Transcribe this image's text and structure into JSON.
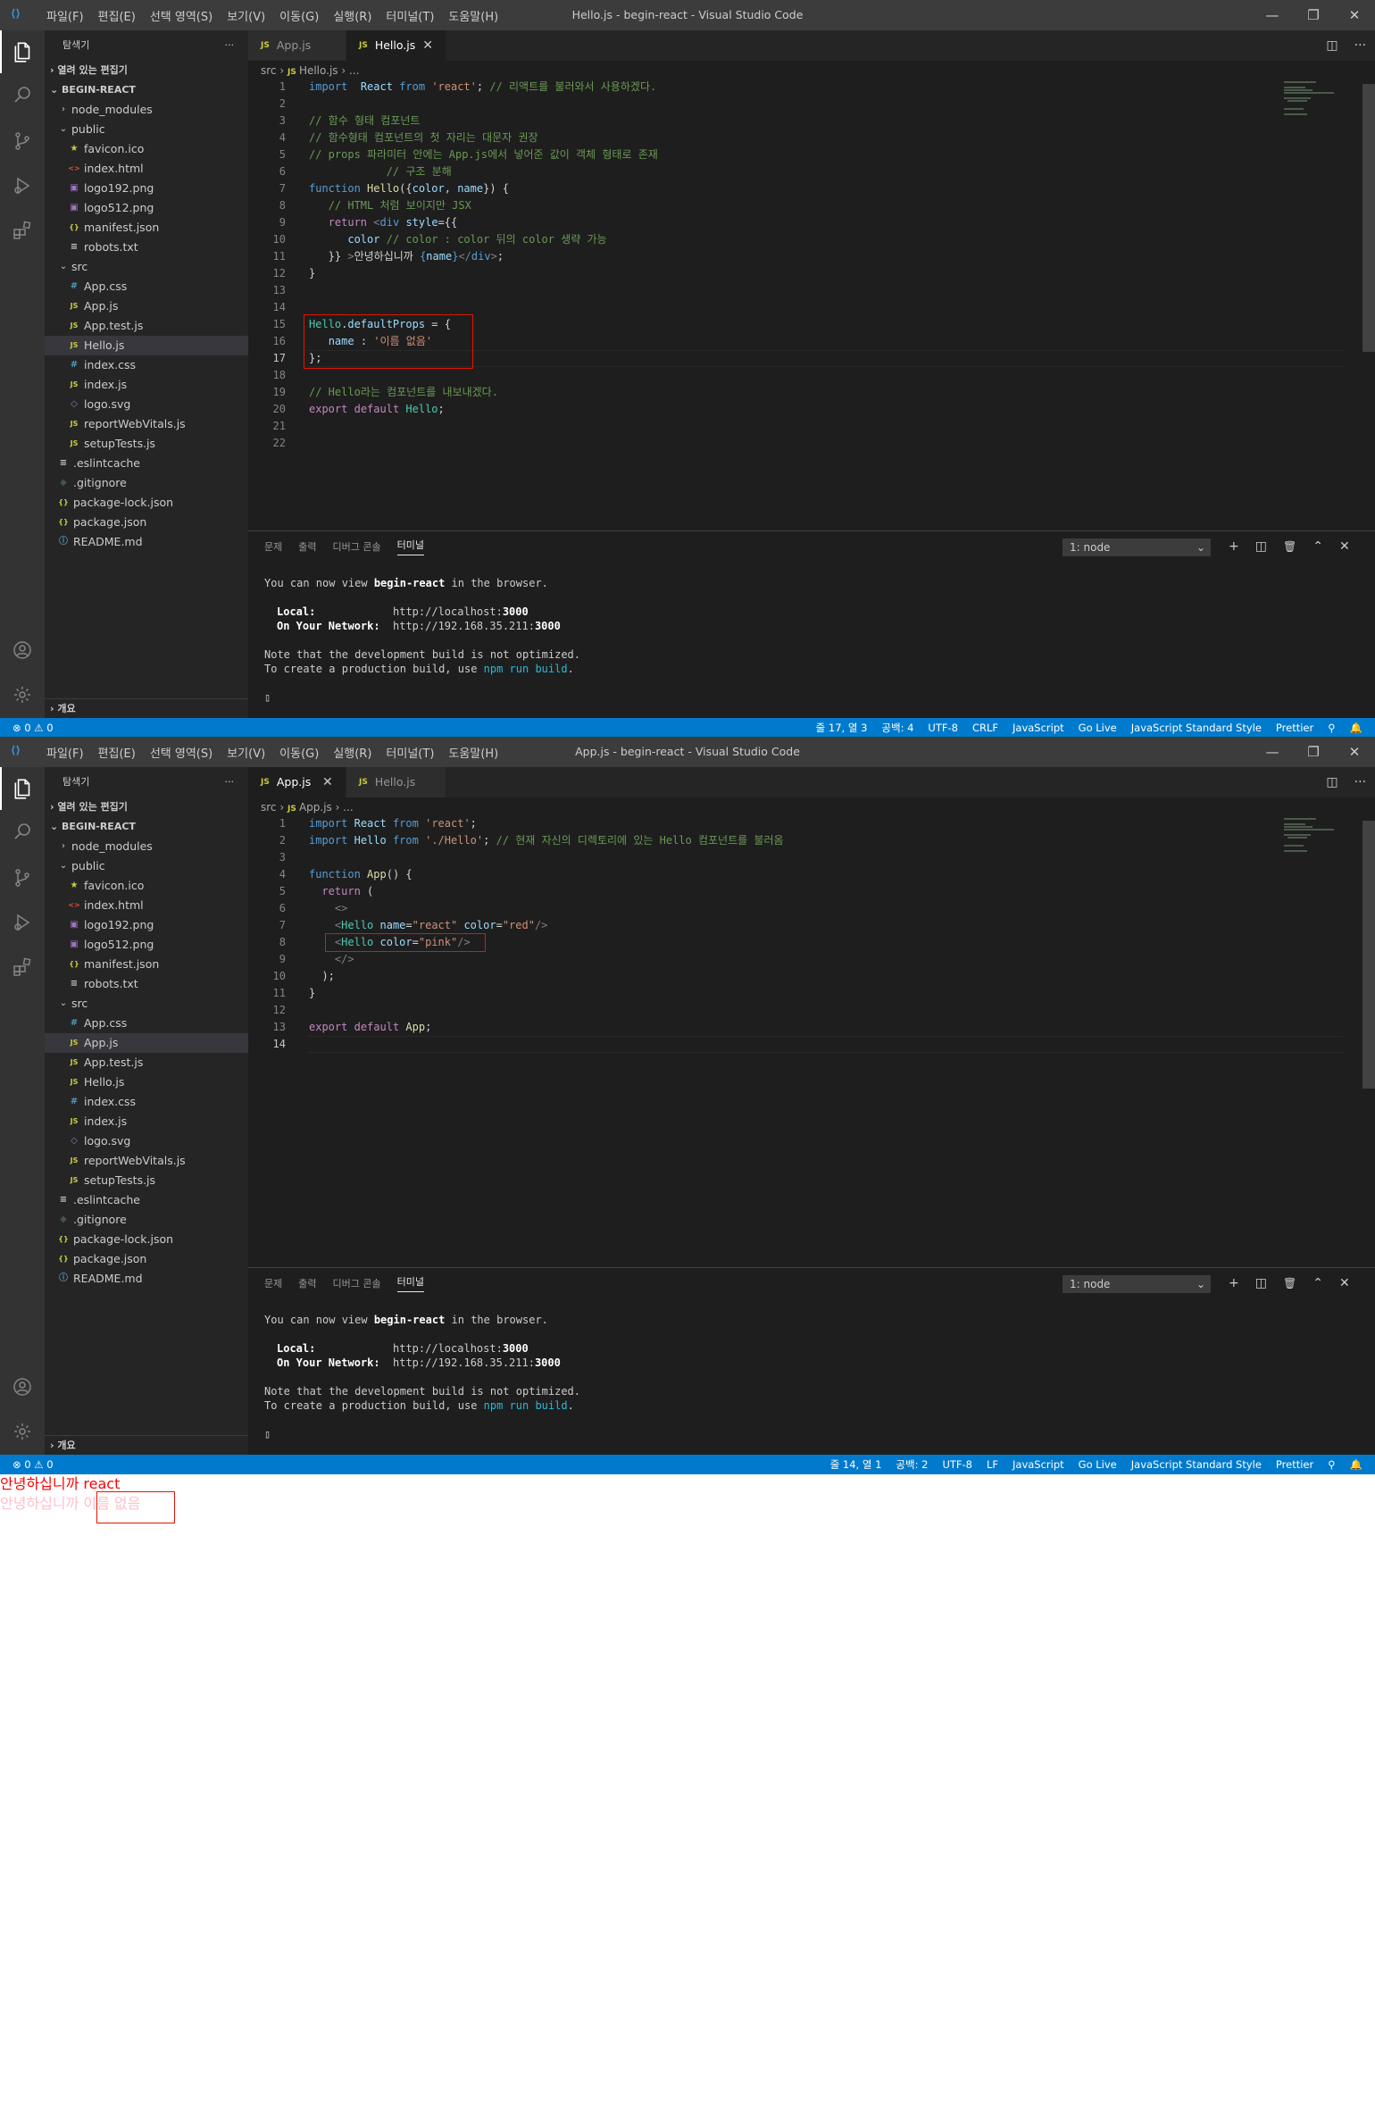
{
  "windows": [
    {
      "title": "Hello.js - begin-react - Visual Studio Code",
      "menu": [
        "파일(F)",
        "편집(E)",
        "선택 영역(S)",
        "보기(V)",
        "이동(G)",
        "실행(R)",
        "터미널(T)",
        "도움말(H)"
      ],
      "sidebar": {
        "header": "탐색기",
        "more": "···",
        "open_editors": "열려 있는 편집기",
        "project": "BEGIN-REACT",
        "selected": "Hello.js",
        "outline": "개요"
      },
      "tabs": [
        {
          "label": "App.js",
          "active": false
        },
        {
          "label": "Hello.js",
          "active": true
        }
      ],
      "breadcrumb": {
        "folder": "src",
        "file": "Hello.js",
        "rest": "..."
      },
      "code": [
        {
          "n": "1",
          "t": [
            [
              "k",
              "import"
            ],
            [
              "",
              "  "
            ],
            [
              "v",
              "React"
            ],
            [
              "",
              " "
            ],
            [
              "k",
              "from"
            ],
            [
              "",
              " "
            ],
            [
              "s",
              "'react'"
            ],
            [
              "",
              "; "
            ],
            [
              "c",
              "// 리액트를 불러와서 사용하겠다."
            ]
          ]
        },
        {
          "n": "2",
          "t": []
        },
        {
          "n": "3",
          "t": [
            [
              "c",
              "// 함수 형태 컴포넌트"
            ]
          ]
        },
        {
          "n": "4",
          "t": [
            [
              "c",
              "// 함수형태 컴포넌트의 첫 자리는 대문자 권장"
            ]
          ]
        },
        {
          "n": "5",
          "t": [
            [
              "c",
              "// props 파라미터 안에는 App.js에서 넣어준 값이 객체 형태로 존재"
            ]
          ]
        },
        {
          "n": "6",
          "t": [
            [
              "c",
              "            // 구조 분해"
            ]
          ]
        },
        {
          "n": "7",
          "t": [
            [
              "k",
              "function"
            ],
            [
              "",
              " "
            ],
            [
              "f",
              "Hello"
            ],
            [
              "",
              "({"
            ],
            [
              "v",
              "color"
            ],
            [
              "",
              ", "
            ],
            [
              "v",
              "name"
            ],
            [
              "",
              "}) {"
            ]
          ]
        },
        {
          "n": "8",
          "t": [
            [
              "",
              "   "
            ],
            [
              "c",
              "// HTML 처럼 보이지만 JSX"
            ]
          ]
        },
        {
          "n": "9",
          "t": [
            [
              "",
              "   "
            ],
            [
              "kc",
              "return"
            ],
            [
              "",
              " "
            ],
            [
              "p",
              "<"
            ],
            [
              "k",
              "div"
            ],
            [
              "",
              " "
            ],
            [
              "v",
              "style"
            ],
            [
              "",
              "={{"
            ]
          ]
        },
        {
          "n": "10",
          "t": [
            [
              "",
              "      "
            ],
            [
              "v",
              "color"
            ],
            [
              "",
              " "
            ],
            [
              "c",
              "// color : color 뒤의 color 생략 가능"
            ]
          ]
        },
        {
          "n": "11",
          "t": [
            [
              "",
              "   }} "
            ],
            [
              "p",
              ">"
            ],
            [
              "",
              "안녕하십니까 "
            ],
            [
              "k",
              "{"
            ],
            [
              "v",
              "name"
            ],
            [
              "k",
              "}"
            ],
            [
              "p",
              "</"
            ],
            [
              "k",
              "div"
            ],
            [
              "p",
              ">"
            ],
            [
              "",
              ";"
            ]
          ]
        },
        {
          "n": "12",
          "t": [
            [
              "",
              "}"
            ]
          ]
        },
        {
          "n": "13",
          "t": []
        },
        {
          "n": "14",
          "t": []
        },
        {
          "n": "15",
          "t": [
            [
              "t",
              "Hello"
            ],
            [
              "",
              "."
            ],
            [
              "v",
              "defaultProps"
            ],
            [
              "",
              " = {"
            ]
          ]
        },
        {
          "n": "16",
          "t": [
            [
              "",
              "   "
            ],
            [
              "v",
              "name"
            ],
            [
              "",
              " : "
            ],
            [
              "s",
              "'이름 없음'"
            ]
          ]
        },
        {
          "n": "17",
          "t": [
            [
              "",
              "};"
            ]
          ]
        },
        {
          "n": "18",
          "t": []
        },
        {
          "n": "19",
          "t": [
            [
              "c",
              "// Hello라는 컴포넌트를 내보내겠다."
            ]
          ]
        },
        {
          "n": "20",
          "t": [
            [
              "kc",
              "export"
            ],
            [
              "",
              " "
            ],
            [
              "kc",
              "default"
            ],
            [
              "",
              " "
            ],
            [
              "t",
              "Hello"
            ],
            [
              "",
              ";"
            ]
          ]
        },
        {
          "n": "21",
          "t": []
        },
        {
          "n": "22",
          "t": []
        }
      ],
      "current_line": "17",
      "panel": {
        "tabs": [
          "문제",
          "출력",
          "디버그 콘솔",
          "터미널"
        ],
        "active_tab": "터미널",
        "terminal_select": "1: node",
        "terminal": {
          "line1_a": "You can now view ",
          "line1_b": "begin-react",
          "line1_c": " in the browser.",
          "local_label": "Local:",
          "local_pre": "http://localhost:",
          "local_port": "3000",
          "net_label": "On Your Network:",
          "net_pre": "http://192.168.35.211:",
          "net_port": "3000",
          "note1": "Note that the development build is not optimized.",
          "note2_a": "To create a production build, use ",
          "note2_b": "npm run build",
          "note2_c": ".",
          "cursor": "▯"
        }
      },
      "status": {
        "left": "⊗ 0 ⚠ 0",
        "right": [
          "줄 17, 열 3",
          "공백: 4",
          "UTF-8",
          "CRLF",
          "JavaScript",
          "Go Live",
          "JavaScript Standard Style",
          "Prettier",
          "⚲",
          "🔔"
        ]
      }
    },
    {
      "title": "App.js - begin-react - Visual Studio Code",
      "menu": [
        "파일(F)",
        "편집(E)",
        "선택 영역(S)",
        "보기(V)",
        "이동(G)",
        "실행(R)",
        "터미널(T)",
        "도움말(H)"
      ],
      "sidebar": {
        "header": "탐색기",
        "more": "···",
        "open_editors": "열려 있는 편집기",
        "project": "BEGIN-REACT",
        "selected": "App.js",
        "outline": "개요"
      },
      "tabs": [
        {
          "label": "App.js",
          "active": true
        },
        {
          "label": "Hello.js",
          "active": false
        }
      ],
      "breadcrumb": {
        "folder": "src",
        "file": "App.js",
        "rest": "..."
      },
      "code": [
        {
          "n": "1",
          "t": [
            [
              "k",
              "import"
            ],
            [
              "",
              " "
            ],
            [
              "v",
              "React"
            ],
            [
              "",
              " "
            ],
            [
              "k",
              "from"
            ],
            [
              "",
              " "
            ],
            [
              "s",
              "'react'"
            ],
            [
              "",
              ";"
            ]
          ]
        },
        {
          "n": "2",
          "t": [
            [
              "k",
              "import"
            ],
            [
              "",
              " "
            ],
            [
              "v",
              "Hello"
            ],
            [
              "",
              " "
            ],
            [
              "k",
              "from"
            ],
            [
              "",
              " "
            ],
            [
              "s",
              "'./Hello'"
            ],
            [
              "",
              "; "
            ],
            [
              "c",
              "// 현재 자신의 디렉토리에 있는 Hello 컴포넌트를 불러옴"
            ]
          ]
        },
        {
          "n": "3",
          "t": []
        },
        {
          "n": "4",
          "t": [
            [
              "k",
              "function"
            ],
            [
              "",
              " "
            ],
            [
              "f",
              "App"
            ],
            [
              "",
              "() {"
            ]
          ]
        },
        {
          "n": "5",
          "t": [
            [
              "",
              "  "
            ],
            [
              "kc",
              "return"
            ],
            [
              "",
              " ("
            ]
          ]
        },
        {
          "n": "6",
          "t": [
            [
              "",
              "    "
            ],
            [
              "p",
              "<>"
            ]
          ]
        },
        {
          "n": "7",
          "t": [
            [
              "",
              "    "
            ],
            [
              "p",
              "<"
            ],
            [
              "t",
              "Hello"
            ],
            [
              "",
              " "
            ],
            [
              "v",
              "name"
            ],
            [
              "",
              "="
            ],
            [
              "s",
              "\"react\""
            ],
            [
              "",
              " "
            ],
            [
              "v",
              "color"
            ],
            [
              "",
              "="
            ],
            [
              "s",
              "\"red\""
            ],
            [
              "p",
              "/>"
            ]
          ]
        },
        {
          "n": "8",
          "t": [
            [
              "",
              "    "
            ],
            [
              "p",
              "<"
            ],
            [
              "t",
              "Hello"
            ],
            [
              "",
              " "
            ],
            [
              "v",
              "color"
            ],
            [
              "",
              "="
            ],
            [
              "s",
              "\"pink\""
            ],
            [
              "p",
              "/>"
            ]
          ]
        },
        {
          "n": "9",
          "t": [
            [
              "",
              "    "
            ],
            [
              "p",
              "</>"
            ]
          ]
        },
        {
          "n": "10",
          "t": [
            [
              "",
              "  );"
            ]
          ]
        },
        {
          "n": "11",
          "t": [
            [
              "",
              "}"
            ]
          ]
        },
        {
          "n": "12",
          "t": []
        },
        {
          "n": "13",
          "t": [
            [
              "kc",
              "export"
            ],
            [
              "",
              " "
            ],
            [
              "kc",
              "default"
            ],
            [
              "",
              " "
            ],
            [
              "f",
              "App"
            ],
            [
              "",
              ";"
            ]
          ]
        },
        {
          "n": "14",
          "t": []
        }
      ],
      "current_line": "14",
      "panel": {
        "tabs": [
          "문제",
          "출력",
          "디버그 콘솔",
          "터미널"
        ],
        "active_tab": "터미널",
        "terminal_select": "1: node",
        "terminal": {
          "line1_a": "You can now view ",
          "line1_b": "begin-react",
          "line1_c": " in the browser.",
          "local_label": "Local:",
          "local_pre": "http://localhost:",
          "local_port": "3000",
          "net_label": "On Your Network:",
          "net_pre": "http://192.168.35.211:",
          "net_port": "3000",
          "note1": "Note that the development build is not optimized.",
          "note2_a": "To create a production build, use ",
          "note2_b": "npm run build",
          "note2_c": ".",
          "cursor": "▯"
        }
      },
      "status": {
        "left": "⊗ 0 ⚠ 0",
        "right": [
          "줄 14, 열 1",
          "공백: 2",
          "UTF-8",
          "LF",
          "JavaScript",
          "Go Live",
          "JavaScript Standard Style",
          "Prettier",
          "⚲",
          "🔔"
        ]
      }
    }
  ],
  "files": [
    {
      "name": "node_modules",
      "kind": "folder-closed",
      "depth": 1
    },
    {
      "name": "public",
      "kind": "folder-open",
      "depth": 1
    },
    {
      "name": "favicon.ico",
      "kind": "ico",
      "depth": 2
    },
    {
      "name": "index.html",
      "kind": "html",
      "depth": 2
    },
    {
      "name": "logo192.png",
      "kind": "png",
      "depth": 2
    },
    {
      "name": "logo512.png",
      "kind": "png",
      "depth": 2
    },
    {
      "name": "manifest.json",
      "kind": "json",
      "depth": 2
    },
    {
      "name": "robots.txt",
      "kind": "txt",
      "depth": 2
    },
    {
      "name": "src",
      "kind": "folder-open",
      "depth": 1
    },
    {
      "name": "App.css",
      "kind": "css",
      "depth": 2
    },
    {
      "name": "App.js",
      "kind": "js",
      "depth": 2
    },
    {
      "name": "App.test.js",
      "kind": "js",
      "depth": 2
    },
    {
      "name": "Hello.js",
      "kind": "js",
      "depth": 2
    },
    {
      "name": "index.css",
      "kind": "css",
      "depth": 2
    },
    {
      "name": "index.js",
      "kind": "js",
      "depth": 2
    },
    {
      "name": "logo.svg",
      "kind": "svg",
      "depth": 2
    },
    {
      "name": "reportWebVitals.js",
      "kind": "js",
      "depth": 2
    },
    {
      "name": "setupTests.js",
      "kind": "js",
      "depth": 2
    },
    {
      "name": ".eslintcache",
      "kind": "txt",
      "depth": 1
    },
    {
      "name": ".gitignore",
      "kind": "git",
      "depth": 1
    },
    {
      "name": "package-lock.json",
      "kind": "json",
      "depth": 1
    },
    {
      "name": "package.json",
      "kind": "json",
      "depth": 1
    },
    {
      "name": "README.md",
      "kind": "md",
      "depth": 1
    }
  ],
  "rendered_output": {
    "line1_prefix": "안녕하십니까 ",
    "line1_name": "react",
    "line2_prefix": "안녕하십니까 ",
    "line2_name": "이름 없음"
  },
  "colors": {
    "accent": "#007acc",
    "red_box": "#e51400",
    "output_red": "#ff0000",
    "output_pink": "#ffc0cb"
  }
}
